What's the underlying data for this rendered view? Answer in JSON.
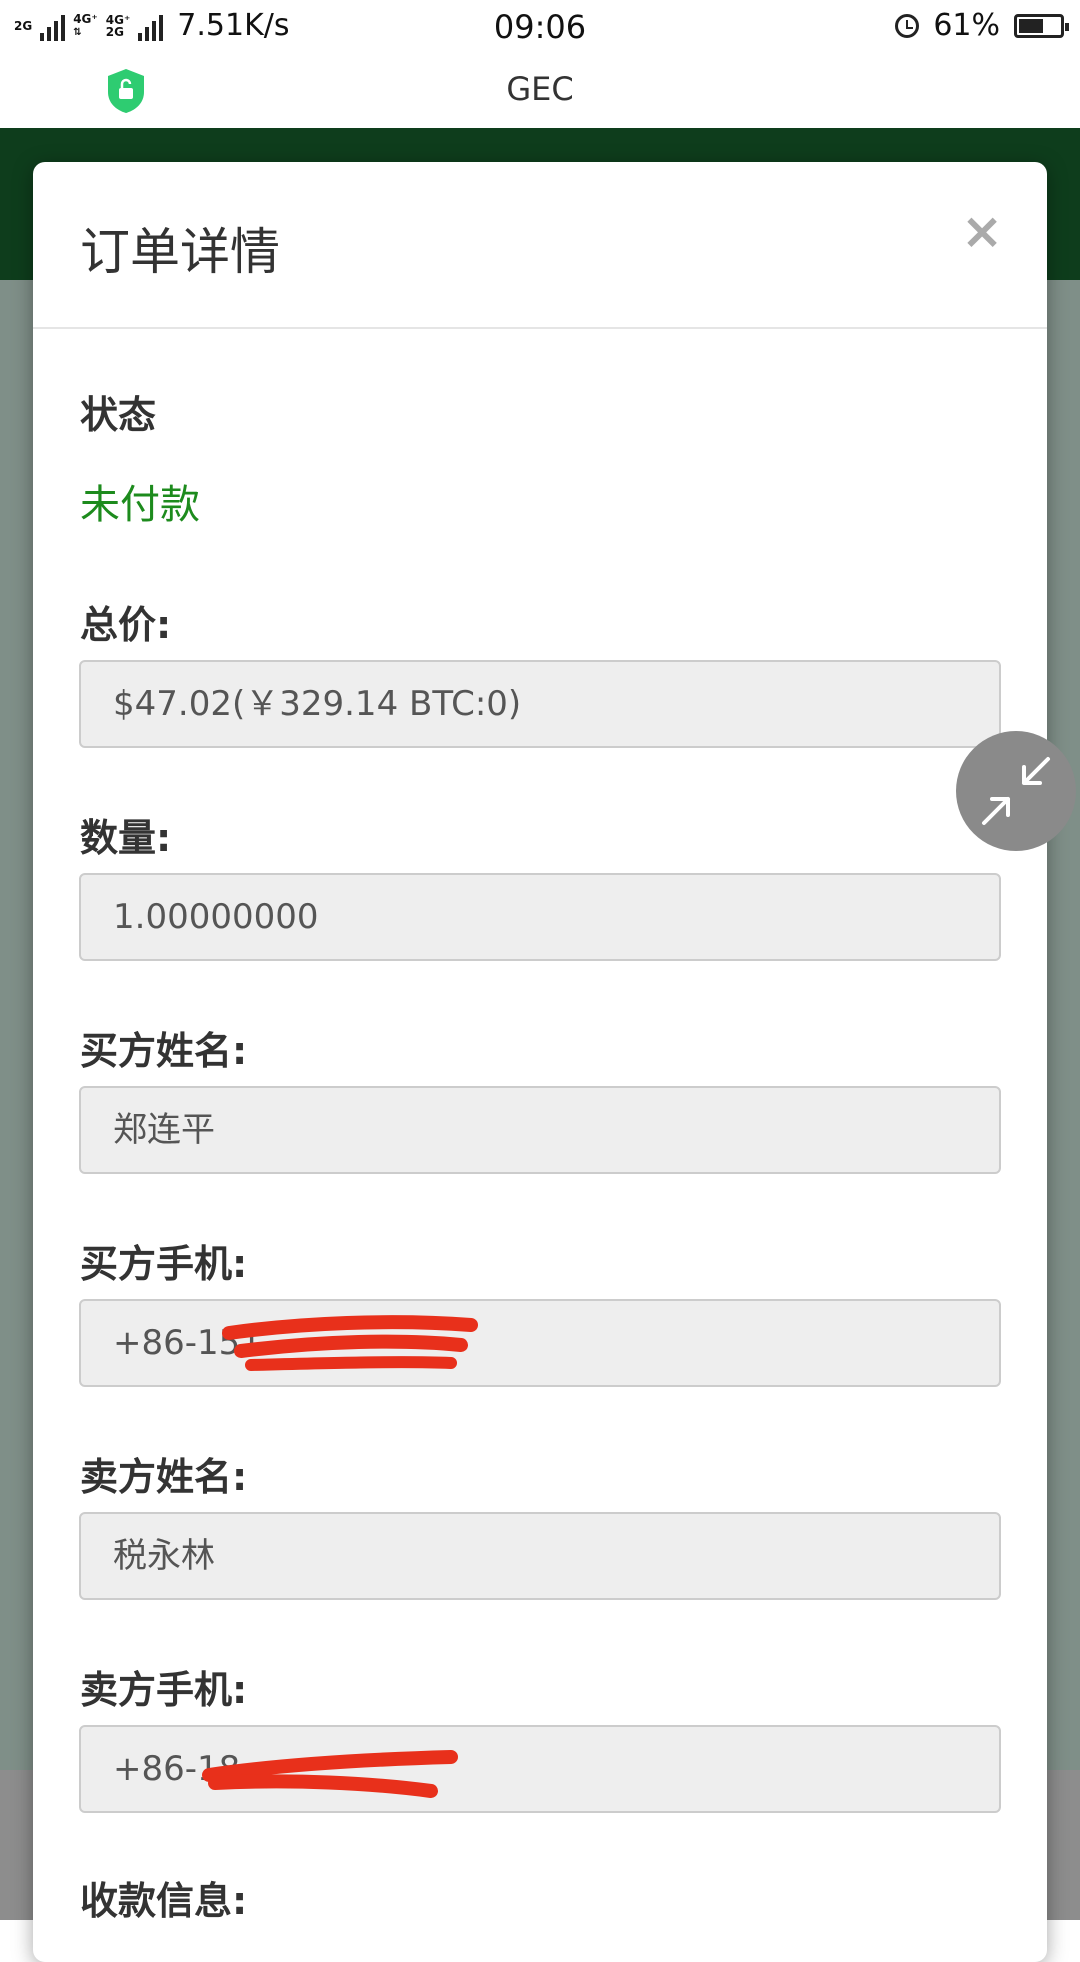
{
  "status_bar": {
    "net_2g": "2G",
    "net_4g_a": "4G⁺",
    "net_4g_b": "4G⁺",
    "net_2g_b": "2G",
    "speed": "7.51K/s",
    "time": "09:06",
    "battery_percent": "61%",
    "battery_level": 0.61
  },
  "app_bar": {
    "title": "GEC"
  },
  "modal": {
    "title": "订单详情",
    "close": "×",
    "fields": {
      "status_label": "状态",
      "status_value": "未付款",
      "total_label": "总价:",
      "total_value": "$47.02(￥329.14  BTC:0)",
      "quantity_label": "数量:",
      "quantity_value": "1.00000000",
      "buyer_name_label": "买方姓名:",
      "buyer_name_value": "郑连平",
      "buyer_phone_label": "买方手机:",
      "buyer_phone_value": "+86-151",
      "seller_name_label": "卖方姓名:",
      "seller_name_value": "税永林",
      "seller_phone_label": "卖方手机:",
      "seller_phone_value": "+86-18",
      "payment_info_label": "收款信息:"
    }
  },
  "colors": {
    "header_green": "#0e3d1c",
    "status_green": "#1d8b1d",
    "redaction_red": "#e8301b",
    "shield_green": "#2ecc71"
  },
  "icons": {
    "shield": "shield-lock-icon",
    "float": "collapse-arrows-icon",
    "alarm": "alarm-clock-icon",
    "battery": "battery-icon"
  }
}
